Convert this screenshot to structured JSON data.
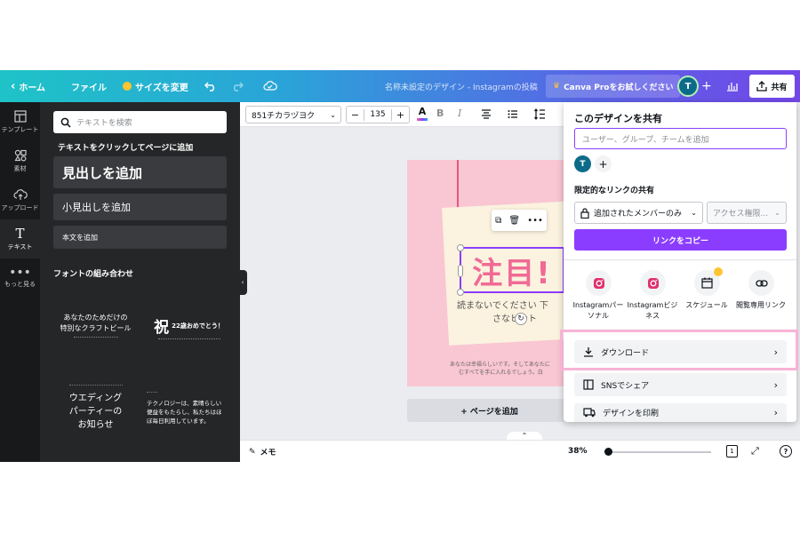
{
  "topbar": {
    "home": "ホーム",
    "file": "ファイル",
    "resize": "サイズを変更",
    "title": "名称未設定のデザイン - Instagramの投稿",
    "try_pro": "Canva Proをお試しください",
    "avatar_initial": "T",
    "share": "共有"
  },
  "rail": {
    "items": [
      {
        "label": "テンプレート",
        "icon": "template-icon"
      },
      {
        "label": "素材",
        "icon": "elements-icon"
      },
      {
        "label": "アップロード",
        "icon": "upload-icon"
      },
      {
        "label": "テキスト",
        "icon": "text-icon"
      },
      {
        "label": "もっと見る",
        "icon": "more-icon"
      }
    ]
  },
  "panel": {
    "search_placeholder": "テキストを検索",
    "instruction": "テキストをクリックしてページに追加",
    "heading_button": "見出しを追加",
    "subheading_button": "小見出しを追加",
    "body_button": "本文を追加",
    "combos_title": "フォントの組み合わせ",
    "combo1": {
      "line1": "あなたのためだけの",
      "line2": "特別なクラフトビール"
    },
    "combo2": {
      "mark": "祝",
      "line1": "22歳おめでとう！"
    },
    "combo3": {
      "line1": "ウエディング",
      "line2": "パーティーの",
      "line3": "お知らせ"
    },
    "combo4": {
      "line1": "テクノロジーは、素晴らしい",
      "line2": "便益をもたらし、私たちはほ",
      "line3": "ぼ毎日利用しています。"
    }
  },
  "toolbar": {
    "font": "851チカラヅヨク",
    "font_size": "135",
    "minus": "−",
    "plus": "+"
  },
  "canvas": {
    "heading": "注目!",
    "subtext": "読まないでください 下",
    "subtext2": "さなヒント",
    "footnote1": "あなたは幸福らしいです。そしてあなたに",
    "footnote2": "むすべてを手に入れるでしょう。白"
  },
  "add_page": "+ ページを追加",
  "bottombar": {
    "notes": "メモ",
    "zoom": "38%",
    "zoom_level": 0.38,
    "page_num": "1"
  },
  "share": {
    "title": "このデザインを共有",
    "people_placeholder": "ユーザー、グループ、チームを追加",
    "avatar_initial": "T",
    "restricted_label": "限定的なリンクの共有",
    "access_select": "追加されたメンバーのみ",
    "permission_select": "アクセス権限...",
    "copy_link": "リンクをコピー",
    "options": [
      {
        "label1": "Instagramパー",
        "label2": "ソナル",
        "icon": "instagram-icon"
      },
      {
        "label1": "Instagramビジ",
        "label2": "ネス",
        "icon": "instagram-icon"
      },
      {
        "label1": "スケジュール",
        "label2": "",
        "icon": "calendar-icon"
      },
      {
        "label1": "閲覧専用リンク",
        "label2": "",
        "icon": "link-icon"
      }
    ],
    "download": "ダウンロード",
    "sns_share": "SNSでシェア",
    "print": "デザインを印刷"
  },
  "colors": {
    "accent": "#8b3dff",
    "canvas_bg": "#f9c6d3",
    "heading_pink": "#f06a95",
    "highlight": "#f7b3d5"
  }
}
